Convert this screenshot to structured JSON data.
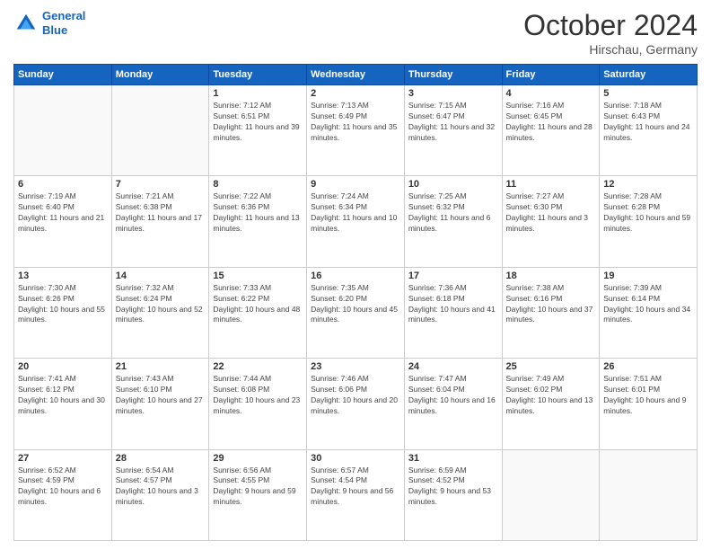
{
  "header": {
    "logo_line1": "General",
    "logo_line2": "Blue",
    "month": "October 2024",
    "location": "Hirschau, Germany"
  },
  "weekdays": [
    "Sunday",
    "Monday",
    "Tuesday",
    "Wednesday",
    "Thursday",
    "Friday",
    "Saturday"
  ],
  "weeks": [
    [
      {
        "day": "",
        "info": ""
      },
      {
        "day": "",
        "info": ""
      },
      {
        "day": "1",
        "info": "Sunrise: 7:12 AM\nSunset: 6:51 PM\nDaylight: 11 hours and 39 minutes."
      },
      {
        "day": "2",
        "info": "Sunrise: 7:13 AM\nSunset: 6:49 PM\nDaylight: 11 hours and 35 minutes."
      },
      {
        "day": "3",
        "info": "Sunrise: 7:15 AM\nSunset: 6:47 PM\nDaylight: 11 hours and 32 minutes."
      },
      {
        "day": "4",
        "info": "Sunrise: 7:16 AM\nSunset: 6:45 PM\nDaylight: 11 hours and 28 minutes."
      },
      {
        "day": "5",
        "info": "Sunrise: 7:18 AM\nSunset: 6:43 PM\nDaylight: 11 hours and 24 minutes."
      }
    ],
    [
      {
        "day": "6",
        "info": "Sunrise: 7:19 AM\nSunset: 6:40 PM\nDaylight: 11 hours and 21 minutes."
      },
      {
        "day": "7",
        "info": "Sunrise: 7:21 AM\nSunset: 6:38 PM\nDaylight: 11 hours and 17 minutes."
      },
      {
        "day": "8",
        "info": "Sunrise: 7:22 AM\nSunset: 6:36 PM\nDaylight: 11 hours and 13 minutes."
      },
      {
        "day": "9",
        "info": "Sunrise: 7:24 AM\nSunset: 6:34 PM\nDaylight: 11 hours and 10 minutes."
      },
      {
        "day": "10",
        "info": "Sunrise: 7:25 AM\nSunset: 6:32 PM\nDaylight: 11 hours and 6 minutes."
      },
      {
        "day": "11",
        "info": "Sunrise: 7:27 AM\nSunset: 6:30 PM\nDaylight: 11 hours and 3 minutes."
      },
      {
        "day": "12",
        "info": "Sunrise: 7:28 AM\nSunset: 6:28 PM\nDaylight: 10 hours and 59 minutes."
      }
    ],
    [
      {
        "day": "13",
        "info": "Sunrise: 7:30 AM\nSunset: 6:26 PM\nDaylight: 10 hours and 55 minutes."
      },
      {
        "day": "14",
        "info": "Sunrise: 7:32 AM\nSunset: 6:24 PM\nDaylight: 10 hours and 52 minutes."
      },
      {
        "day": "15",
        "info": "Sunrise: 7:33 AM\nSunset: 6:22 PM\nDaylight: 10 hours and 48 minutes."
      },
      {
        "day": "16",
        "info": "Sunrise: 7:35 AM\nSunset: 6:20 PM\nDaylight: 10 hours and 45 minutes."
      },
      {
        "day": "17",
        "info": "Sunrise: 7:36 AM\nSunset: 6:18 PM\nDaylight: 10 hours and 41 minutes."
      },
      {
        "day": "18",
        "info": "Sunrise: 7:38 AM\nSunset: 6:16 PM\nDaylight: 10 hours and 37 minutes."
      },
      {
        "day": "19",
        "info": "Sunrise: 7:39 AM\nSunset: 6:14 PM\nDaylight: 10 hours and 34 minutes."
      }
    ],
    [
      {
        "day": "20",
        "info": "Sunrise: 7:41 AM\nSunset: 6:12 PM\nDaylight: 10 hours and 30 minutes."
      },
      {
        "day": "21",
        "info": "Sunrise: 7:43 AM\nSunset: 6:10 PM\nDaylight: 10 hours and 27 minutes."
      },
      {
        "day": "22",
        "info": "Sunrise: 7:44 AM\nSunset: 6:08 PM\nDaylight: 10 hours and 23 minutes."
      },
      {
        "day": "23",
        "info": "Sunrise: 7:46 AM\nSunset: 6:06 PM\nDaylight: 10 hours and 20 minutes."
      },
      {
        "day": "24",
        "info": "Sunrise: 7:47 AM\nSunset: 6:04 PM\nDaylight: 10 hours and 16 minutes."
      },
      {
        "day": "25",
        "info": "Sunrise: 7:49 AM\nSunset: 6:02 PM\nDaylight: 10 hours and 13 minutes."
      },
      {
        "day": "26",
        "info": "Sunrise: 7:51 AM\nSunset: 6:01 PM\nDaylight: 10 hours and 9 minutes."
      }
    ],
    [
      {
        "day": "27",
        "info": "Sunrise: 6:52 AM\nSunset: 4:59 PM\nDaylight: 10 hours and 6 minutes."
      },
      {
        "day": "28",
        "info": "Sunrise: 6:54 AM\nSunset: 4:57 PM\nDaylight: 10 hours and 3 minutes."
      },
      {
        "day": "29",
        "info": "Sunrise: 6:56 AM\nSunset: 4:55 PM\nDaylight: 9 hours and 59 minutes."
      },
      {
        "day": "30",
        "info": "Sunrise: 6:57 AM\nSunset: 4:54 PM\nDaylight: 9 hours and 56 minutes."
      },
      {
        "day": "31",
        "info": "Sunrise: 6:59 AM\nSunset: 4:52 PM\nDaylight: 9 hours and 53 minutes."
      },
      {
        "day": "",
        "info": ""
      },
      {
        "day": "",
        "info": ""
      }
    ]
  ]
}
